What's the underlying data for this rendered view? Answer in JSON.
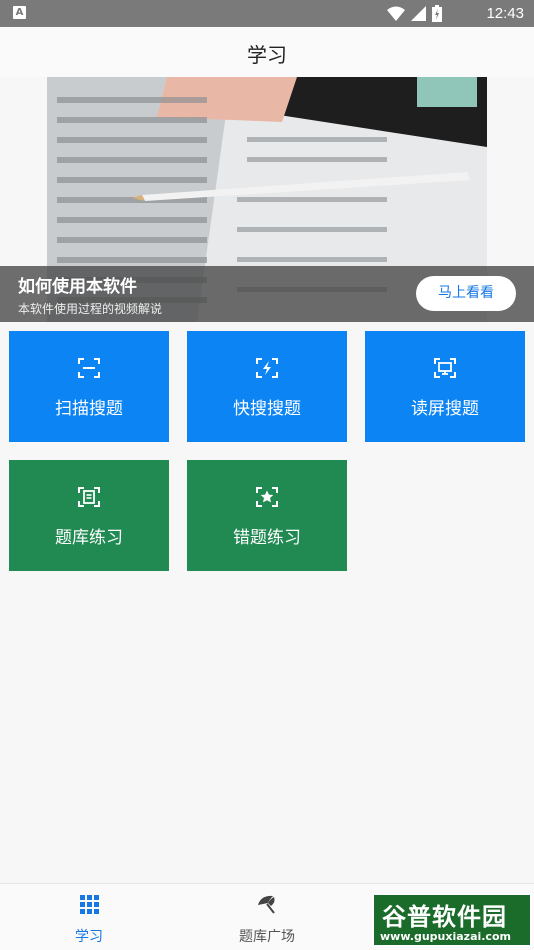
{
  "status_bar": {
    "app_indicator": "A",
    "time": "12:43",
    "bar_color": "#7a7a7a"
  },
  "header": {
    "title": "学习"
  },
  "banner": {
    "title": "如何使用本软件",
    "subtitle": "本软件使用过程的视频解说",
    "button_label": "马上看看"
  },
  "tiles": [
    {
      "label": "扫描搜题",
      "icon": "scan-icon",
      "color": "#0c84f4"
    },
    {
      "label": "快搜搜题",
      "icon": "quick-scan-icon",
      "color": "#0c84f4"
    },
    {
      "label": "读屏搜题",
      "icon": "screen-read-icon",
      "color": "#0c84f4"
    },
    {
      "label": "题库练习",
      "icon": "question-bank-icon",
      "color": "#218a52"
    },
    {
      "label": "错题练习",
      "icon": "wrong-question-icon",
      "color": "#218a52"
    }
  ],
  "bottom_nav": [
    {
      "label": "学习",
      "icon": "grid-icon",
      "active": true
    },
    {
      "label": "题库广场",
      "icon": "umbrella-icon",
      "active": false
    },
    {
      "label": "",
      "icon": "person-icon",
      "active": false
    }
  ],
  "watermark": {
    "name": "谷普软件园",
    "url": "www.gupuxiazai.com"
  },
  "accent_color": "#1677e5"
}
